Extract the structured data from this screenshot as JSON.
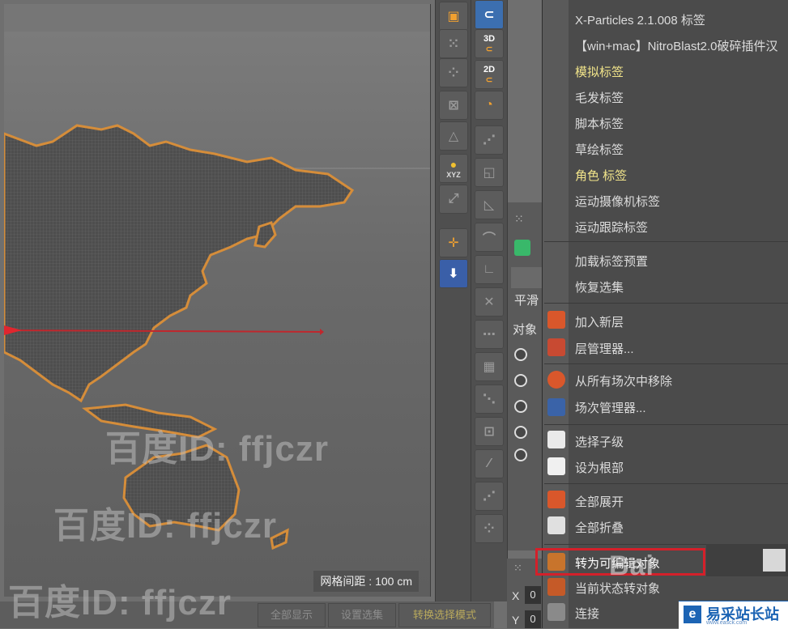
{
  "viewport": {
    "grid_label": "网格间距 : 100 cm"
  },
  "bottom_buttons": [
    "全部显示",
    "设置选集",
    "转换选择模式"
  ],
  "attr_panel": {
    "smooth": "平滑",
    "object_label": "对象",
    "x_label": "X",
    "y_label": "Y",
    "x_value": "0",
    "y_value": "0"
  },
  "menu": {
    "top_items": [
      "X-Particles 2.1.008 标签",
      "【win+mac】NitroBlast2.0破碎插件汉",
      "模拟标签",
      "毛发标签",
      "脚本标签",
      "草绘标签",
      "角色 标签",
      "运动摄像机标签",
      "运动跟踪标签"
    ],
    "preset_items": [
      "加载标签预置",
      "恢复选集"
    ],
    "layer_items": [
      "加入新层",
      "层管理器..."
    ],
    "take_items": [
      "从所有场次中移除",
      "场次管理器..."
    ],
    "hierarchy_items": [
      "选择子级",
      "设为根部"
    ],
    "expand_items": [
      "全部展开",
      "全部折叠"
    ],
    "convert_items": [
      "转为可编辑对象",
      "当前状态转对象",
      "连接"
    ]
  },
  "watermarks": [
    "百度ID: ffjczr",
    "百度ID: ffjczr",
    "百度ID: ffjczr",
    "Bai"
  ],
  "logo": {
    "mark": "e",
    "name": "易采站长站",
    "url": "www.easck.com"
  },
  "colors": {
    "highlight": "#d4202a",
    "menu_yellow": "#f1e48a",
    "accent_orange": "#f0a030"
  },
  "tool_labels": {
    "three_d": "3D",
    "two_d": "2D",
    "xyz": "XYZ"
  }
}
